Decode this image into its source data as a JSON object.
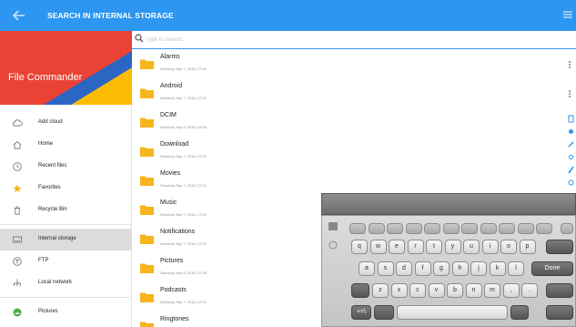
{
  "toolbar": {
    "title": "SEARCH IN INTERNAL STORAGE",
    "back_icon": "arrow-left-icon",
    "menu_icon": "hamburger-menu-icon"
  },
  "search": {
    "placeholder": "Type to search..."
  },
  "drawer": {
    "app_name": "File Commander",
    "items": [
      {
        "label": "Add cloud",
        "icon": "cloud-add-icon"
      },
      {
        "label": "Home",
        "icon": "home-icon"
      },
      {
        "label": "Recent files",
        "icon": "clock-icon"
      },
      {
        "label": "Favorites",
        "icon": "star-icon"
      },
      {
        "label": "Recycle Bin",
        "icon": "trash-icon"
      },
      {
        "label": "Internal storage",
        "icon": "storage-icon"
      },
      {
        "label": "FTP",
        "icon": "ftp-icon"
      },
      {
        "label": "Local network",
        "icon": "network-icon"
      },
      {
        "label": "Pictures",
        "icon": "image-icon"
      }
    ]
  },
  "files": [
    {
      "name": "Alarms",
      "meta": "Directory   Sep 7, 2018, 17:01"
    },
    {
      "name": "Android",
      "meta": "Directory   Sep 7, 2018, 17:01"
    },
    {
      "name": "DCIM",
      "meta": "Directory   Sep 8, 2018, 04:08"
    },
    {
      "name": "Download",
      "meta": "Directory   Sep 7, 2018, 17:01"
    },
    {
      "name": "Movies",
      "meta": "Directory   Sep 7, 2018, 17:01"
    },
    {
      "name": "Music",
      "meta": "Directory   Sep 7, 2018, 17:01"
    },
    {
      "name": "Notifications",
      "meta": "Directory   Sep 7, 2018, 17:01"
    },
    {
      "name": "Pictures",
      "meta": "Directory   Sep 8, 2018, 07:26"
    },
    {
      "name": "Podcasts",
      "meta": "Directory   Sep 7, 2018, 17:01"
    },
    {
      "name": "Ringtones",
      "meta": ""
    }
  ],
  "keyboard": {
    "row1": [
      "q",
      "w",
      "e",
      "r",
      "t",
      "y",
      "u",
      "i",
      "o",
      "p"
    ],
    "row2": [
      "a",
      "s",
      "d",
      "f",
      "g",
      "h",
      "j",
      "k",
      "l"
    ],
    "row3": [
      "z",
      "x",
      "c",
      "v",
      "b",
      "n",
      "m",
      ",",
      "."
    ],
    "done_label": "Done",
    "sym_label": "+=\\"
  },
  "colors": {
    "accent": "#2c96f0",
    "folder": "#f6b51c",
    "banner_red": "#ea4335",
    "banner_yellow": "#fbbc05",
    "banner_blue": "#2b66c5"
  }
}
